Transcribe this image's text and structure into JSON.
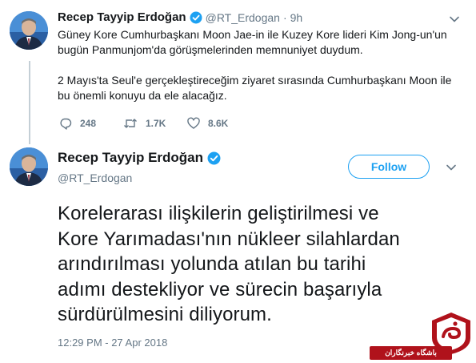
{
  "reply_tweet": {
    "author_name": "Recep Tayyip Erdoğan",
    "handle": "@RT_Erdogan",
    "separator": "·",
    "time_ago": "9h",
    "lines": [
      "Güney Kore Cumhurbaşkanı Moon Jae-in ile Kuzey Kore lideri Kim Jong-un'un",
      "bugün Panmunjom'da görüşmelerinden memnuniyet duydum.",
      "2 Mayıs'ta Seul'e gerçekleştireceğim ziyaret sırasında Cumhurbaşkanı Moon ile",
      "bu önemli konuyu da ele alacağız."
    ],
    "replies": "248",
    "retweets": "1.7K",
    "likes": "8.6K",
    "menu_icon": "chevron-down-icon"
  },
  "main_tweet": {
    "author_name": "Recep Tayyip Erdoğan",
    "handle": "@RT_Erdogan",
    "follow_label": "Follow",
    "lines": [
      "Korelerarası ilişkilerin geliştirilmesi ve",
      "Kore Yarımadası'nın nükleer silahlardan",
      "arındırılması yolunda atılan bu tarihi",
      "adımı destekliyor ve sürecin başarıyla",
      "sürdürülmesini diliyorum."
    ],
    "timestamp": "12:29 PM - 27 Apr 2018",
    "menu_icon": "chevron-down-icon"
  },
  "watermark": {
    "text": "باشگاه خبرنگاران"
  },
  "colors": {
    "accent": "#1da1f2",
    "muted": "#657786",
    "thread_line": "#c4cfd6",
    "watermark_red": "#b0121b"
  }
}
